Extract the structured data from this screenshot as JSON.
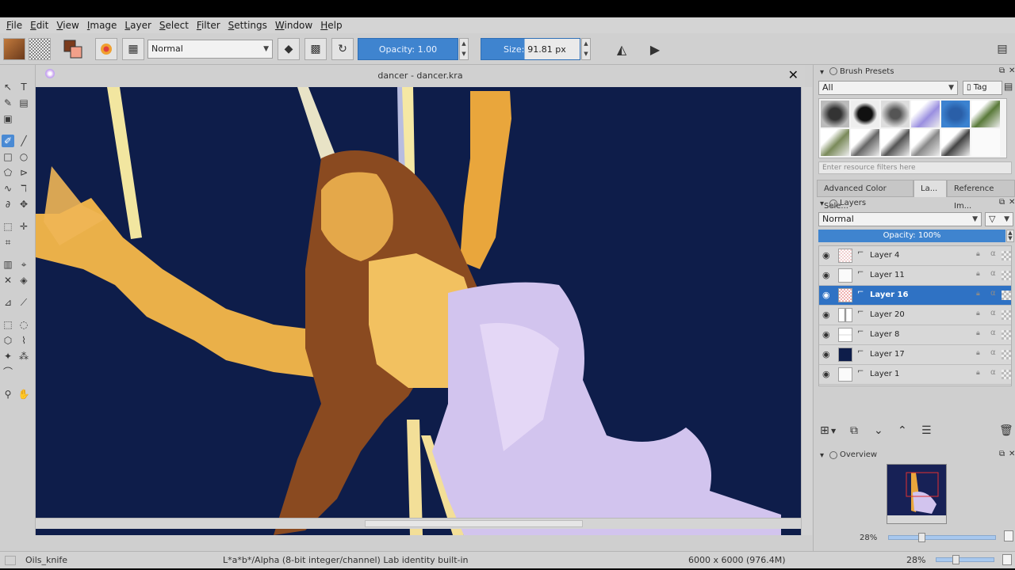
{
  "window": {
    "title": "dancer - dancer.kra"
  },
  "menu": [
    "File",
    "Edit",
    "View",
    "Image",
    "Layer",
    "Select",
    "Filter",
    "Settings",
    "Window",
    "Help"
  ],
  "toolbar": {
    "blend_mode": "Normal",
    "opacity_label": "Opacity:  1.00",
    "size_label": "Size:",
    "size_value": "91.81 px"
  },
  "brush_presets": {
    "title": "Brush Presets",
    "filter": "All",
    "tag_label": "Tag",
    "search_placeholder": "Enter resource filters here"
  },
  "tabs": [
    "Advanced Color Sele...",
    "La...",
    "Reference Im..."
  ],
  "layers_panel": {
    "title": "Layers",
    "blend_mode": "Normal",
    "opacity": "Opacity:  100%",
    "layers": [
      {
        "name": "Layer 4",
        "selected": false
      },
      {
        "name": "Layer 11",
        "selected": false
      },
      {
        "name": "Layer 16",
        "selected": true
      },
      {
        "name": "Layer 20",
        "selected": false
      },
      {
        "name": "Layer 8",
        "selected": false
      },
      {
        "name": "Layer 17",
        "selected": false
      },
      {
        "name": "Layer 1",
        "selected": false
      }
    ]
  },
  "overview": {
    "title": "Overview",
    "zoom": "28%"
  },
  "status": {
    "brush": "Oils_knife",
    "color_space": "L*a*b*/Alpha (8-bit integer/channel)  Lab identity built-in",
    "dimensions": "6000 x 6000 (976.4M)",
    "zoom": "28%"
  },
  "colors": {
    "canvas_bg": "#0e1d4a",
    "accent": "#3f84cf",
    "selected_layer": "#2f72c4"
  }
}
